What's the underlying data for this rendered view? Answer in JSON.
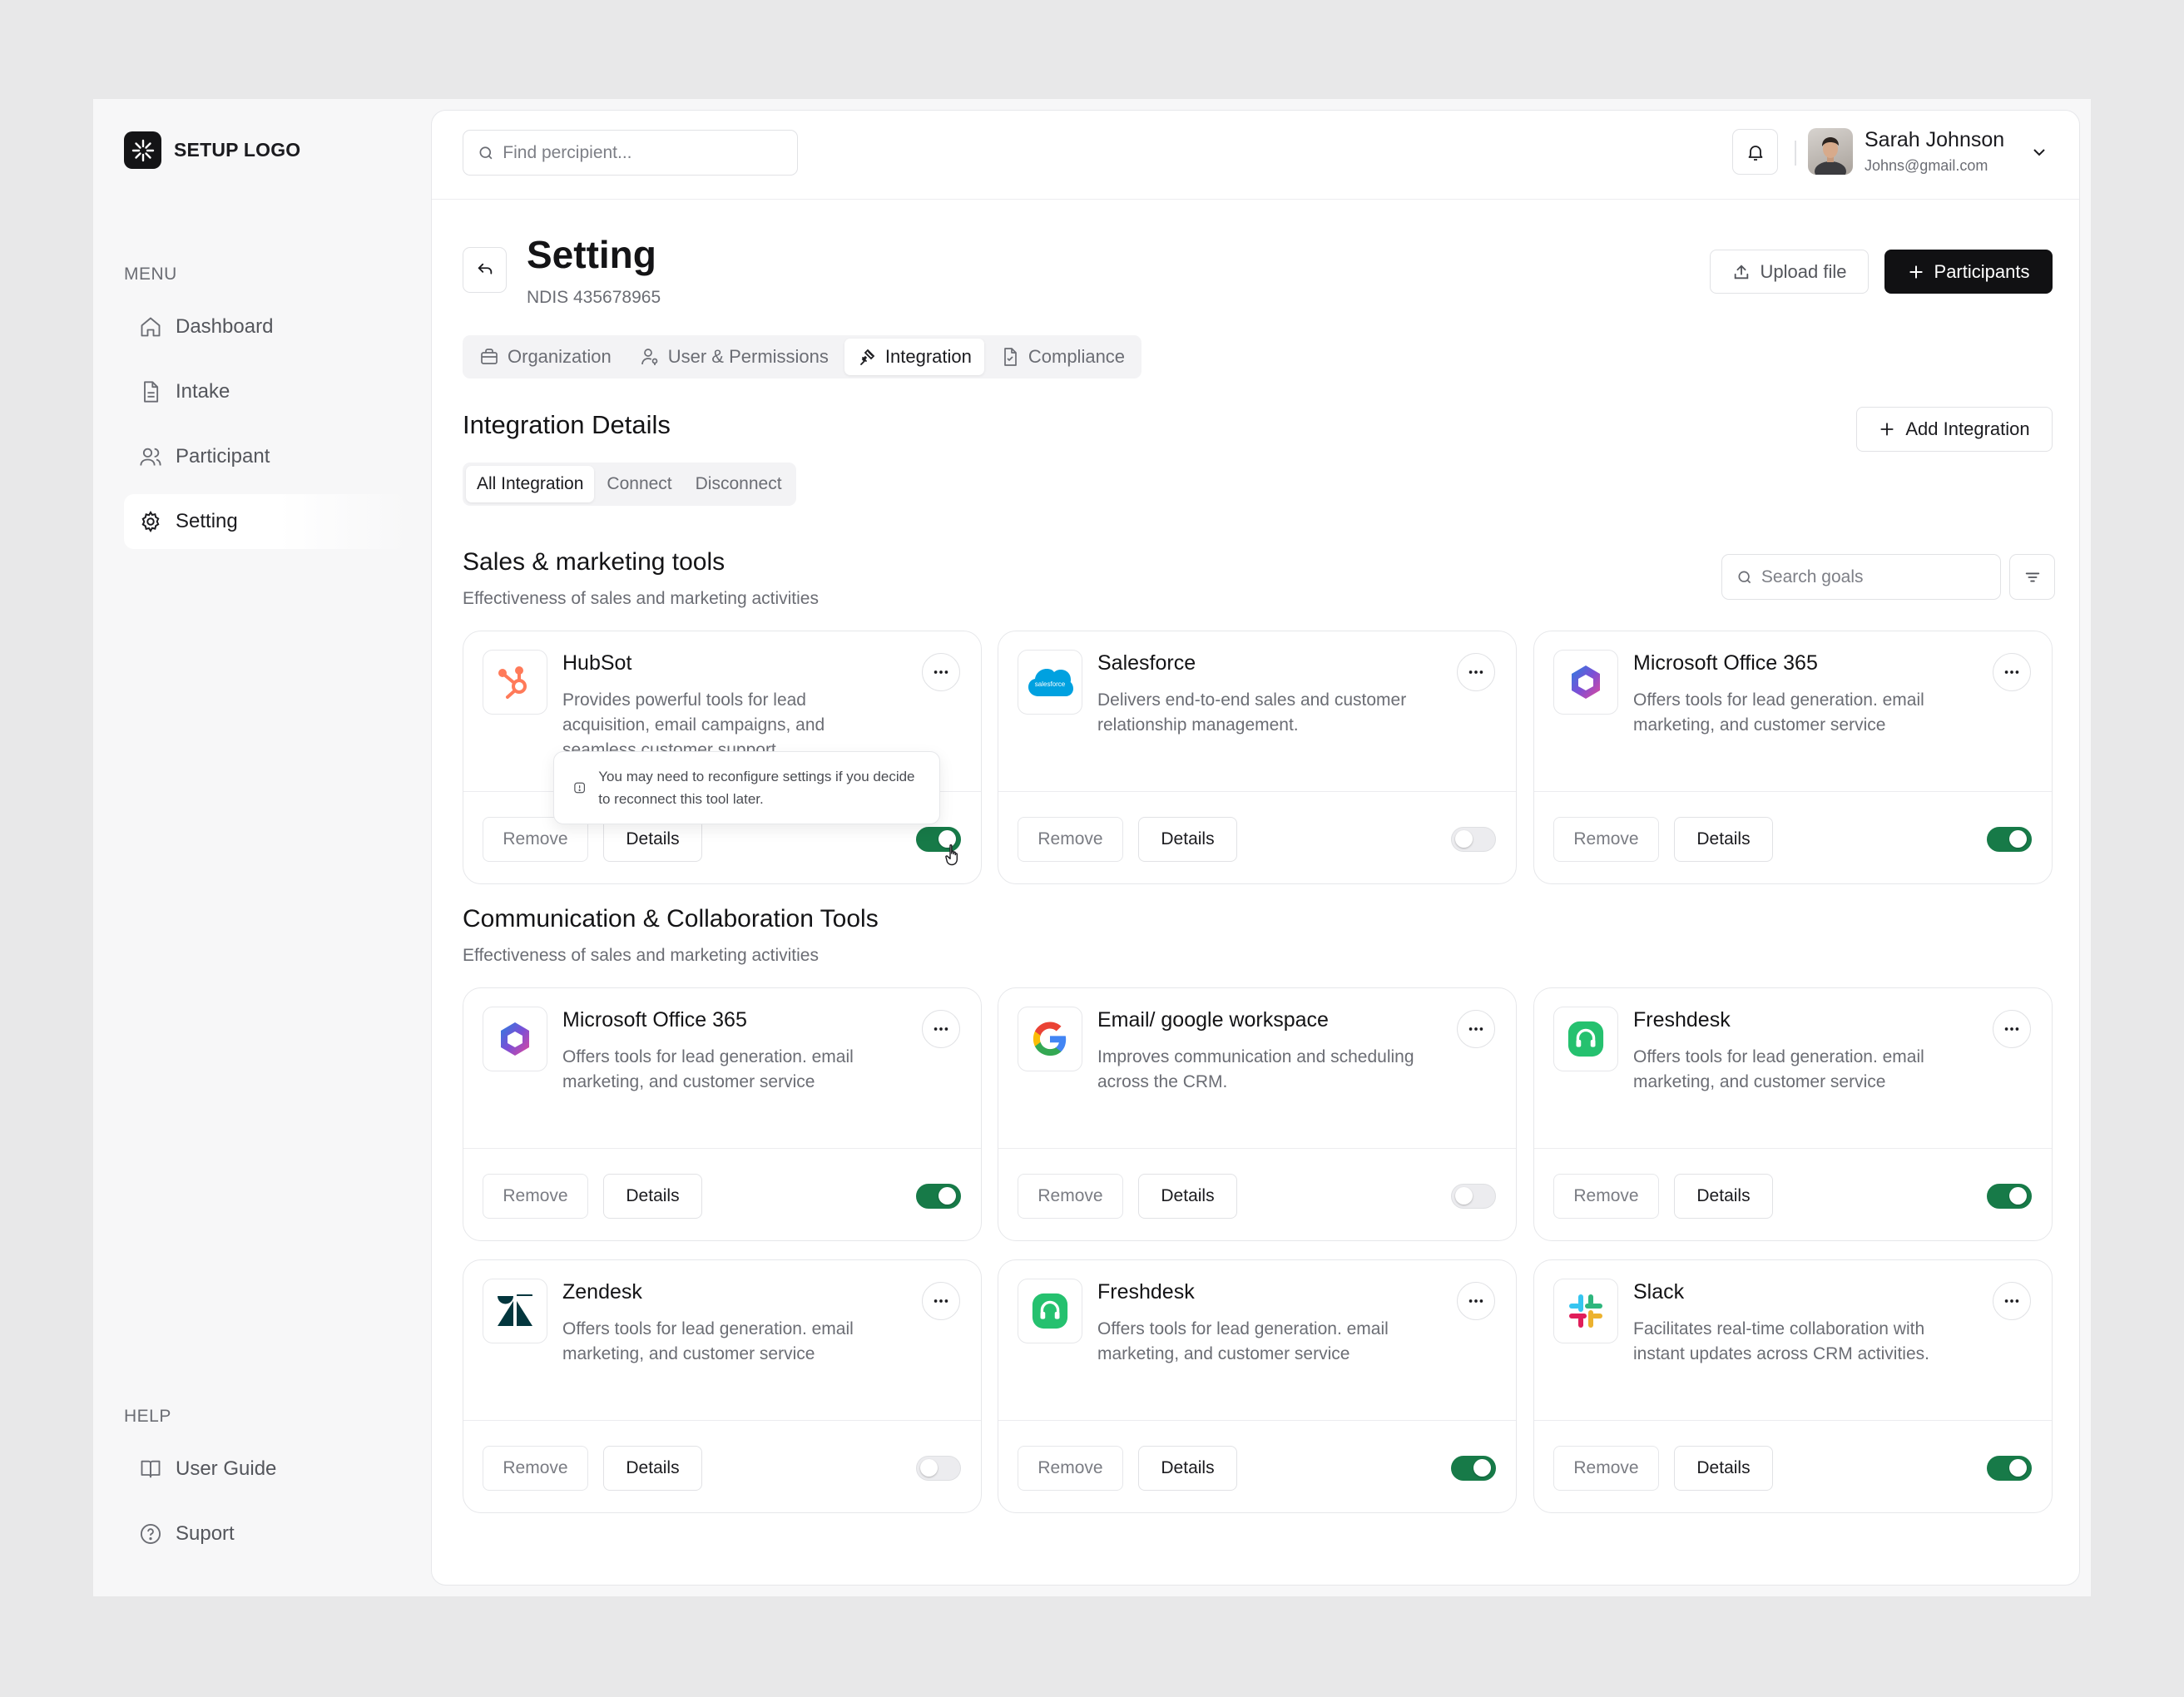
{
  "sidebar": {
    "logo_text": "SETUP LOGO",
    "menu_label": "MENU",
    "menu_items": [
      {
        "label": "Dashboard",
        "icon": "home-icon"
      },
      {
        "label": "Intake",
        "icon": "document-icon"
      },
      {
        "label": "Participant",
        "icon": "users-icon"
      },
      {
        "label": "Setting",
        "icon": "gear-icon",
        "active": true
      }
    ],
    "help_label": "HELP",
    "help_items": [
      {
        "label": "User Guide",
        "icon": "book-icon"
      },
      {
        "label": "Suport",
        "icon": "help-circle-icon"
      }
    ]
  },
  "header": {
    "search_placeholder": "Find percipient...",
    "user_name": "Sarah Johnson",
    "user_email": "Johns@gmail.com"
  },
  "page": {
    "title": "Setting",
    "subtitle": "NDIS 435678965",
    "upload_label": "Upload file",
    "participants_label": "Participants",
    "tabs": [
      {
        "label": "Organization",
        "icon": "briefcase-icon"
      },
      {
        "label": "User & Permissions",
        "icon": "user-key-icon"
      },
      {
        "label": "Integration",
        "icon": "plug-icon",
        "active": true
      },
      {
        "label": "Compliance",
        "icon": "file-check-icon"
      }
    ]
  },
  "integration": {
    "heading": "Integration Details",
    "add_label": "Add Integration",
    "filters": [
      "All Integration",
      "Connect",
      "Disconnect"
    ],
    "active_filter": "All Integration",
    "search_placeholder": "Search goals"
  },
  "sections": [
    {
      "title": "Sales & marketing tools",
      "description": "Effectiveness of sales and marketing activities",
      "cards": [
        {
          "name": "HubSot",
          "icon": "hubspot-icon",
          "description": "Provides powerful tools for lead acquisition, email campaigns, and seamless customer support",
          "enabled": true
        },
        {
          "name": "Salesforce",
          "icon": "salesforce-icon",
          "description": "Delivers end-to-end sales and customer relationship management.",
          "enabled": false
        },
        {
          "name": "Microsoft Office 365",
          "icon": "microsoft-365-icon",
          "description": "Offers tools for lead generation. email marketing, and customer service",
          "enabled": true
        }
      ]
    },
    {
      "title": "Communication & Collaboration Tools",
      "description": "Effectiveness of sales and marketing activities",
      "cards": [
        {
          "name": "Microsoft Office 365",
          "icon": "microsoft-365-icon",
          "description": "Offers tools for lead generation. email marketing, and customer service",
          "enabled": true
        },
        {
          "name": "Email/ google workspace",
          "icon": "google-icon",
          "description": "Improves communication and scheduling across the CRM.",
          "enabled": false
        },
        {
          "name": "Freshdesk",
          "icon": "freshdesk-icon",
          "description": "Offers tools for lead generation. email marketing, and customer service",
          "enabled": true
        },
        {
          "name": "Zendesk",
          "icon": "zendesk-icon",
          "description": "Offers tools for lead generation. email marketing, and customer service",
          "enabled": false
        },
        {
          "name": "Freshdesk",
          "icon": "freshdesk-icon",
          "description": "Offers tools for lead generation. email marketing, and customer service",
          "enabled": true
        },
        {
          "name": "Slack",
          "icon": "slack-icon",
          "description": "Facilitates real-time collaboration with instant updates across CRM activities.",
          "enabled": true
        }
      ]
    }
  ],
  "card_actions": {
    "remove": "Remove",
    "details": "Details"
  },
  "tooltip": "You may need to reconfigure settings if you decide to reconnect this tool later.",
  "colors": {
    "toggle_on": "#177a48",
    "primary_button": "#111113",
    "hubspot": "#ff7a59",
    "salesforce": "#00a1e0",
    "freshdesk": "#25c16f"
  }
}
